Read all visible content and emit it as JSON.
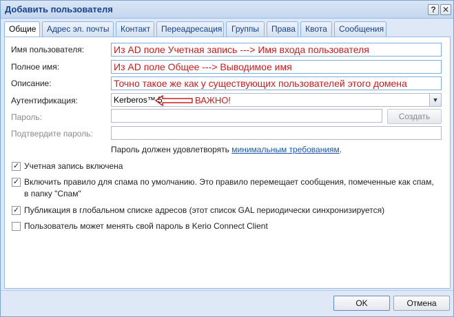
{
  "window": {
    "title": "Добавить пользователя",
    "help_glyph": "?",
    "close_glyph": "✕"
  },
  "tabs": [
    {
      "label": "Общие",
      "active": true
    },
    {
      "label": "Адрес эл. почты"
    },
    {
      "label": "Контакт"
    },
    {
      "label": "Переадресация"
    },
    {
      "label": "Группы"
    },
    {
      "label": "Права"
    },
    {
      "label": "Квота"
    },
    {
      "label": "Сообщения"
    }
  ],
  "form": {
    "username_label": "Имя пользователя:",
    "username_value": "Из AD поле Учетная запись ---> Имя входа пользователя",
    "fullname_label": "Полное имя:",
    "fullname_value": "Из AD поле Общее ---> Выводимое имя",
    "description_label": "Описание:",
    "description_value": "Точно такое же как у существующих пользователей этого домена",
    "auth_label": "Аутентификация:",
    "auth_value": "Kerberos™ 5",
    "auth_annotation": "ВАЖНО!",
    "password_label": "Пароль:",
    "password_value": "",
    "create_button": "Создать",
    "confirm_label": "Подтвердите пароль:",
    "confirm_value": "",
    "hint_prefix": "Пароль должен удовлетворять ",
    "hint_link": "минимальным требованиям",
    "hint_suffix": "."
  },
  "checkboxes": [
    {
      "label": "Учетная запись включена",
      "checked": true
    },
    {
      "label": "Включить правило для спама по умолчанию. Это правило перемещает сообщения, помеченные как спам, в папку \"Спам\"",
      "checked": true
    },
    {
      "label": "Публикация в глобальном списке адресов (этот список GAL периодически синхронизируется)",
      "checked": true
    },
    {
      "label": "Пользователь может менять свой пароль в Kerio Connect Client",
      "checked": false
    }
  ],
  "footer": {
    "ok_label": "OK",
    "cancel_label": "Отмена"
  },
  "colors": {
    "annotation": "#c81e1e",
    "title_text": "#15428b",
    "link": "#1a56b5"
  }
}
